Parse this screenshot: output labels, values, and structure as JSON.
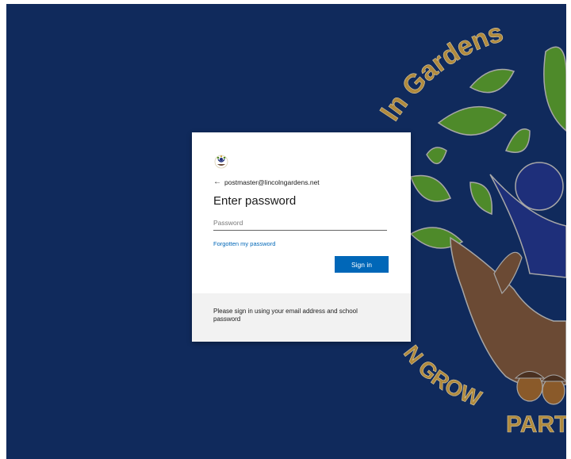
{
  "background": {
    "top_arc_text": "ln Gardens",
    "bottom_arc_text_1": "N GROW",
    "bottom_arc_text_2": "PART",
    "colors": {
      "backdrop": "#102a5c",
      "leaf": "#4e8a2a",
      "hand": "#6b4a34",
      "figure": "#1e2f7a",
      "gold_text": "#b08a3e"
    }
  },
  "card": {
    "logo_icon": "school-logo-icon",
    "back_icon": "arrow-left-icon",
    "identity": "postmaster@lincolngardens.net",
    "title": "Enter password",
    "password": {
      "placeholder": "Password",
      "value": ""
    },
    "forgot_label": "Forgotten my password",
    "signin_label": "Sign in",
    "accent": "#0067b8",
    "footer_text": "Please sign in using your email address and school password"
  }
}
